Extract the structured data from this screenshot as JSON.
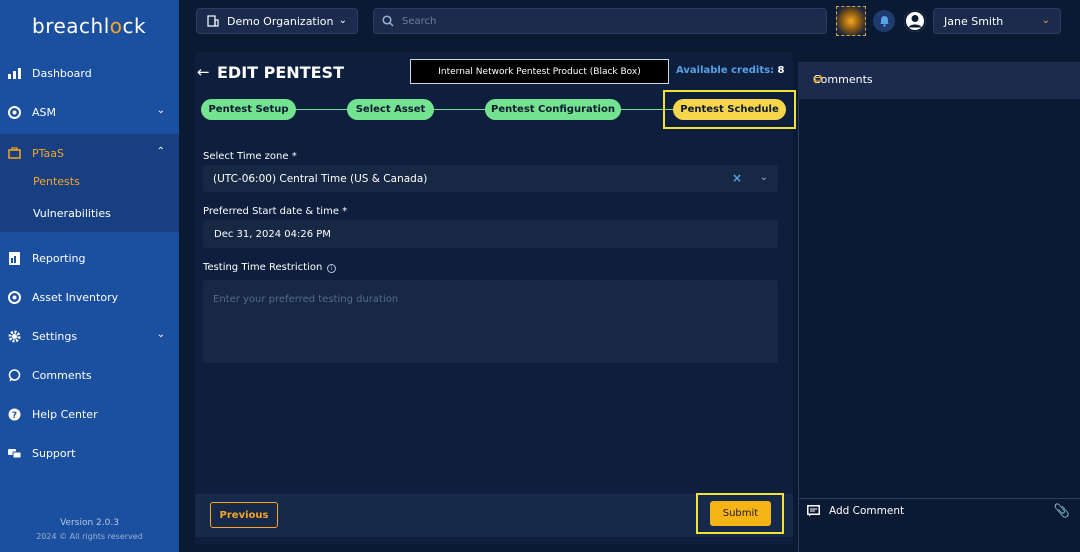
{
  "sidebar": {
    "logo_prefix": "breachl",
    "logo_o": "o",
    "logo_suffix": "ck",
    "items": [
      {
        "label": "Dashboard"
      },
      {
        "label": "ASM"
      },
      {
        "label": "PTaaS"
      },
      {
        "label": "Reporting"
      },
      {
        "label": "Asset Inventory"
      },
      {
        "label": "Settings"
      },
      {
        "label": "Comments"
      },
      {
        "label": "Help Center"
      },
      {
        "label": "Support"
      }
    ],
    "sub_items": [
      {
        "label": "Pentests"
      },
      {
        "label": "Vulnerabilities"
      }
    ],
    "version": "Version 2.0.3",
    "copyright": "2024 © All rights reserved"
  },
  "topbar": {
    "organization": "Demo Organization",
    "search_placeholder": "Search",
    "user_name": "Jane Smith"
  },
  "main": {
    "title": "EDIT PENTEST",
    "product": "Internal Network Pentest Product (Black Box)",
    "credits_label": "Available credits:",
    "credits_value": "8",
    "steps": [
      {
        "label": "Pentest Setup"
      },
      {
        "label": "Select Asset"
      },
      {
        "label": "Pentest Configuration"
      },
      {
        "label": "Pentest Schedule"
      }
    ],
    "timezone_label": "Select Time zone *",
    "timezone_value": "(UTC-06:00) Central Time (US & Canada)",
    "start_label": "Preferred Start date & time *",
    "start_value": "Dec 31, 2024 04:26 PM",
    "restriction_label": "Testing Time Restriction",
    "restriction_placeholder": "Enter your preferred testing duration",
    "previous_label": "Previous",
    "submit_label": "Submit"
  },
  "comments": {
    "title": "Comments",
    "add_label": "Add Comment"
  },
  "colors": {
    "sidebar": "#1b4fa0",
    "accent": "#f5a623",
    "step_done": "#74e38f",
    "step_current": "#f7d54a"
  }
}
